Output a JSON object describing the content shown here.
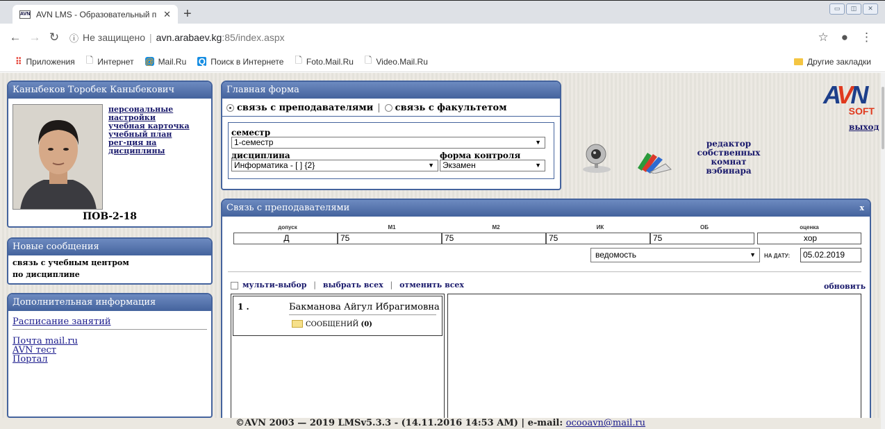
{
  "browser": {
    "tab_title": "AVN LMS - Образовательный п",
    "favicon_text": "AVN",
    "security": "Не защищено",
    "url_host": "avn.arabaev.kg",
    "url_path": ":85/index.aspx",
    "bookmarks": [
      "Приложения",
      "Интернет",
      "Mail.Ru",
      "Поиск в Интернете",
      "Foto.Mail.Ru",
      "Video.Mail.Ru"
    ],
    "other_bookmarks": "Другие закладки"
  },
  "profile": {
    "name": "Каныбеков Торобек Каныбекович",
    "links": [
      "персональные настройки",
      "учебная карточка",
      "учебный план",
      "рег-ция на дисциплины"
    ],
    "group": "ПОВ-2-18"
  },
  "messages": {
    "title": "Новые сообщения",
    "items": [
      "связь с учебным центром",
      "по дисциплине"
    ]
  },
  "info": {
    "title": "Дополнительная информация",
    "schedule": "Расписание занятий",
    "links": [
      "Почта mail.ru",
      "AVN тест",
      "Портал"
    ]
  },
  "main_form": {
    "title": "Главная форма",
    "radio_teachers": "связь с преподавателями",
    "radio_faculty": "связь с факультетом",
    "semester_label": "семестр",
    "semester_value": "1-семестр",
    "discipline_label": "дисциплина",
    "discipline_value": "Информатика - [ ] {2}",
    "control_label": "форма контроля",
    "control_value": "Экзамен"
  },
  "right": {
    "logo_soft": "SOFT",
    "exit": "выход",
    "webinar": "редактор собственных комнат вэбинара"
  },
  "teachers_panel": {
    "title": "Связь с преподавателями",
    "close": "x",
    "columns": [
      "допуск",
      "М1",
      "М2",
      "ИК",
      "ОБ",
      "оценка"
    ],
    "values": [
      "Д",
      "75",
      "75",
      "75",
      "75",
      "хор"
    ],
    "sheet": "ведомость",
    "date_label": "НА ДАТУ:",
    "date_value": "05.02.2019",
    "multi": "мульти-выбор",
    "select_all": "выбрать всех",
    "unselect_all": "отменить всех",
    "refresh": "обновить",
    "teacher_index": "1 .",
    "teacher_name": "Бакманова Айгул Ибрагимовна",
    "messages_label": "СООБЩЕНИЙ",
    "messages_count": "(0)"
  },
  "footer": {
    "text": "©AVN 2003 — 2019 LMSv5.3.3 - (14.11.2016 14:53 AM) | e-mail: ",
    "email": "ocooavn@mail.ru"
  }
}
